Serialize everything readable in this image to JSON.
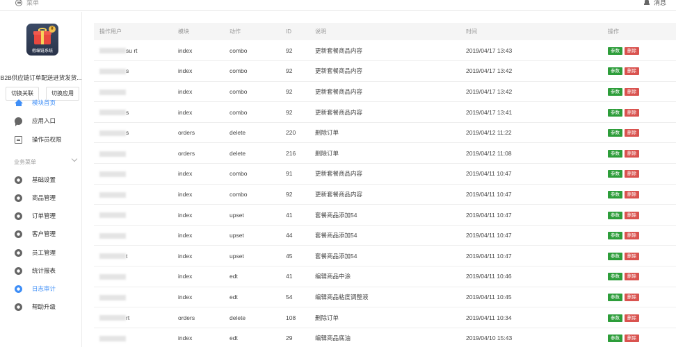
{
  "topbar": {
    "menu_label": "菜单",
    "notify_label": "消息"
  },
  "sidebar": {
    "logo_text": "假编链系统",
    "app_name": "B2B供应链订单配送进货发货...",
    "buttons": {
      "switch_link": "切换关联",
      "switch_app": "切换应用"
    },
    "items_top": [
      {
        "label": "模块首页",
        "icon": "home-icon",
        "active": true
      },
      {
        "label": "应用入口",
        "icon": "chat-icon"
      },
      {
        "label": "操作员权限",
        "icon": "document-icon"
      }
    ],
    "section_label": "业务菜单",
    "items_business": [
      {
        "label": "基础设置",
        "icon": "gear-icon"
      },
      {
        "label": "商品管理",
        "icon": "gear-icon"
      },
      {
        "label": "订单管理",
        "icon": "gear-icon"
      },
      {
        "label": "客户管理",
        "icon": "gear-icon"
      },
      {
        "label": "员工管理",
        "icon": "gear-icon"
      },
      {
        "label": "统计报表",
        "icon": "gear-icon"
      },
      {
        "label": "日志审计",
        "icon": "gear-icon",
        "active": true
      },
      {
        "label": "帮助升级",
        "icon": "gear-icon"
      }
    ]
  },
  "table": {
    "columns": [
      "操作用户",
      "模块",
      "动作",
      "ID",
      "说明",
      "时间",
      "操作"
    ],
    "action_labels": {
      "param": "参数",
      "delete": "删除"
    },
    "rows": [
      {
        "user": "su   rt",
        "module": "index",
        "action": "combo",
        "id": "92",
        "desc": "更新套餐商品内容",
        "time": "2019/04/17 13:43"
      },
      {
        "user": "s",
        "module": "index",
        "action": "combo",
        "id": "92",
        "desc": "更新套餐商品内容",
        "time": "2019/04/17 13:42"
      },
      {
        "user": "",
        "module": "index",
        "action": "combo",
        "id": "92",
        "desc": "更新套餐商品内容",
        "time": "2019/04/17 13:42"
      },
      {
        "user": "s",
        "module": "index",
        "action": "combo",
        "id": "92",
        "desc": "更新套餐商品内容",
        "time": "2019/04/17 13:41"
      },
      {
        "user": "s",
        "module": "orders",
        "action": "delete",
        "id": "220",
        "desc": "删除订单",
        "time": "2019/04/12 11:22"
      },
      {
        "user": "",
        "module": "orders",
        "action": "delete",
        "id": "216",
        "desc": "删除订单",
        "time": "2019/04/12 11:08"
      },
      {
        "user": "",
        "module": "index",
        "action": "combo",
        "id": "91",
        "desc": "更新套餐商品内容",
        "time": "2019/04/11 10:47"
      },
      {
        "user": "",
        "module": "index",
        "action": "combo",
        "id": "92",
        "desc": "更新套餐商品内容",
        "time": "2019/04/11 10:47"
      },
      {
        "user": "",
        "module": "index",
        "action": "upset",
        "id": "41",
        "desc": "套餐商品添加54",
        "time": "2019/04/11 10:47"
      },
      {
        "user": "",
        "module": "index",
        "action": "upset",
        "id": "44",
        "desc": "套餐商品添加54",
        "time": "2019/04/11 10:47"
      },
      {
        "user": "t",
        "module": "index",
        "action": "upset",
        "id": "45",
        "desc": "套餐商品添加54",
        "time": "2019/04/11 10:47"
      },
      {
        "user": "",
        "module": "index",
        "action": "edt",
        "id": "41",
        "desc": "编辑商品中涂",
        "time": "2019/04/11 10:46"
      },
      {
        "user": "",
        "module": "index",
        "action": "edt",
        "id": "54",
        "desc": "编辑商品粘度调整液",
        "time": "2019/04/11 10:45"
      },
      {
        "user": "rt",
        "module": "orders",
        "action": "delete",
        "id": "108",
        "desc": "删除订单",
        "time": "2019/04/11 10:34"
      },
      {
        "user": "",
        "module": "index",
        "action": "edt",
        "id": "29",
        "desc": "编辑商品底油",
        "time": "2019/04/10 15:43"
      }
    ]
  },
  "colors": {
    "accent": "#3e8ef7",
    "param_button": "#2d9d3a",
    "delete_button": "#d9534f"
  }
}
